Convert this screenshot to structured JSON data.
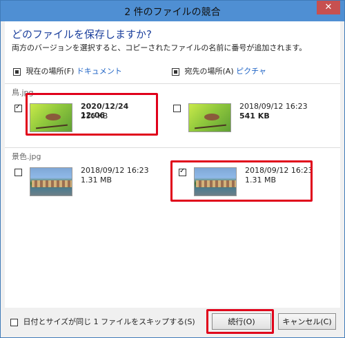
{
  "window": {
    "title": "2 件のファイルの競合",
    "close_label": "✕"
  },
  "question": "どのファイルを保存しますか?",
  "subtext": "両方のバージョンを選択すると、コピーされたファイルの名前に番号が追加されます。",
  "headers": {
    "left_label": "現在の場所(F)",
    "left_link": "ドキュメント",
    "right_label": "宛先の場所(A)",
    "right_link": "ピクチャ"
  },
  "files": [
    {
      "name": "鳥.jpg",
      "left": {
        "checked": true,
        "date": "2020/12/24 12:06",
        "size": "216 KB"
      },
      "right": {
        "checked": false,
        "date": "2018/09/12 16:23",
        "size": "541 KB"
      }
    },
    {
      "name": "景色.jpg",
      "left": {
        "checked": false,
        "date": "2018/09/12 16:23",
        "size": "1.31 MB"
      },
      "right": {
        "checked": true,
        "date": "2018/09/12 16:23",
        "size": "1.31 MB"
      }
    }
  ],
  "footer": {
    "skip_label": "日付とサイズが同じ 1 ファイルをスキップする(S)",
    "continue": "続行(O)",
    "cancel": "キャンセル(C)"
  },
  "icons": {
    "close": "close-icon",
    "thumb_bird": "bird-thumbnail",
    "thumb_land": "landscape-thumbnail"
  }
}
